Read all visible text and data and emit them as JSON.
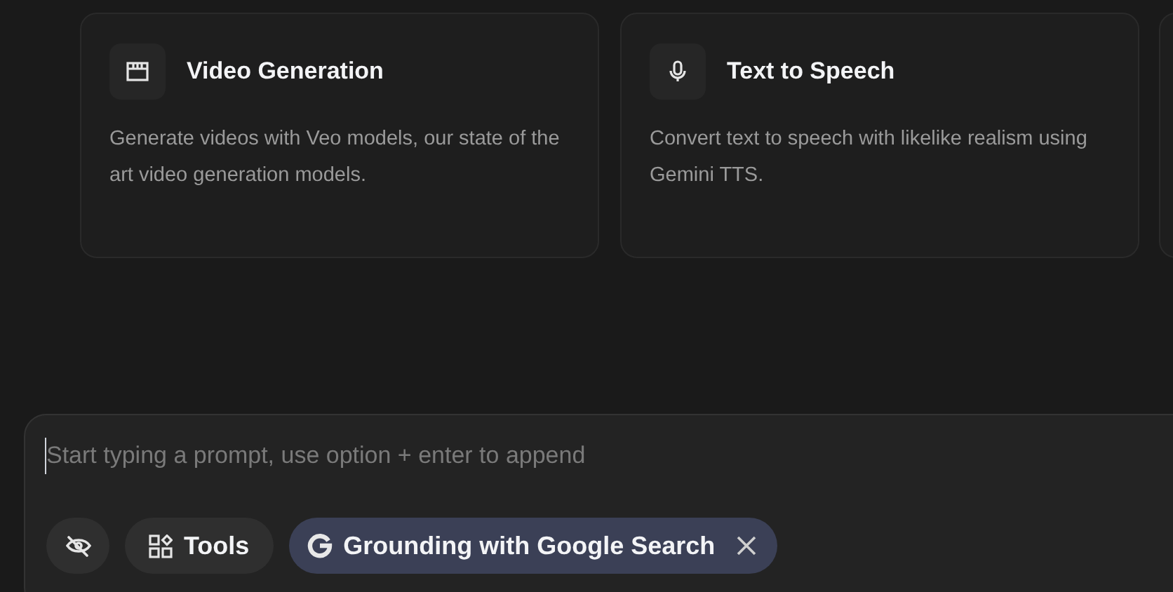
{
  "cards": [
    {
      "kind": "video",
      "title": "Video Generation",
      "description": "Generate videos with Veo models, our state of the art video generation models."
    },
    {
      "kind": "speech",
      "title": "Text to Speech",
      "description": "Convert text to speech with likelike realism using Gemini TTS."
    }
  ],
  "prompt": {
    "placeholder": "Start typing a prompt, use option + enter to append"
  },
  "tools_button": {
    "label": "Tools"
  },
  "grounding_chip": {
    "label": "Grounding with Google Search"
  }
}
